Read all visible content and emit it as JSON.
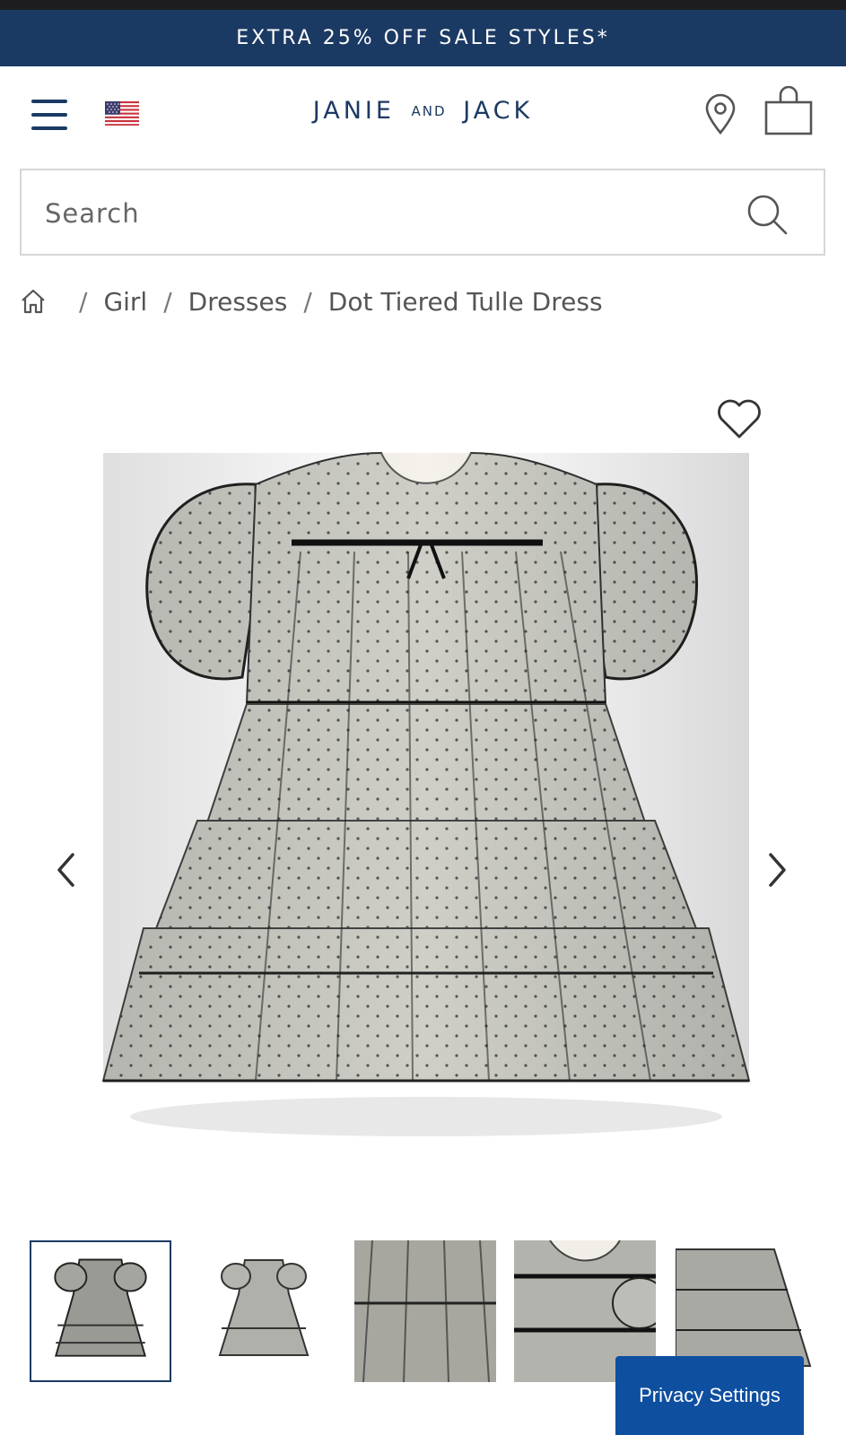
{
  "promo": {
    "text": "EXTRA 25% OFF SALE STYLES*"
  },
  "header": {
    "logo_left": "JANIE",
    "logo_mid": "AND",
    "logo_right": "JACK",
    "menu_icon": "hamburger-icon",
    "flag_icon": "us-flag-icon",
    "store_icon": "location-pin-icon",
    "cart_icon": "shopping-bag-icon"
  },
  "search": {
    "placeholder": "Search",
    "icon": "search-icon"
  },
  "breadcrumb": {
    "home_icon": "home-icon",
    "items": [
      "Girl",
      "Dresses",
      "Dot Tiered Tulle Dress"
    ],
    "separator": "/"
  },
  "gallery": {
    "wishlist_icon": "heart-icon",
    "prev_icon": "chevron-left-icon",
    "next_icon": "chevron-right-icon",
    "thumbnail_count": 5,
    "selected_index": 0
  },
  "privacy": {
    "label": "Privacy Settings"
  },
  "colors": {
    "navy": "#1b3a63",
    "privacy_blue": "#0f4fa0",
    "text_gray": "#555555"
  }
}
